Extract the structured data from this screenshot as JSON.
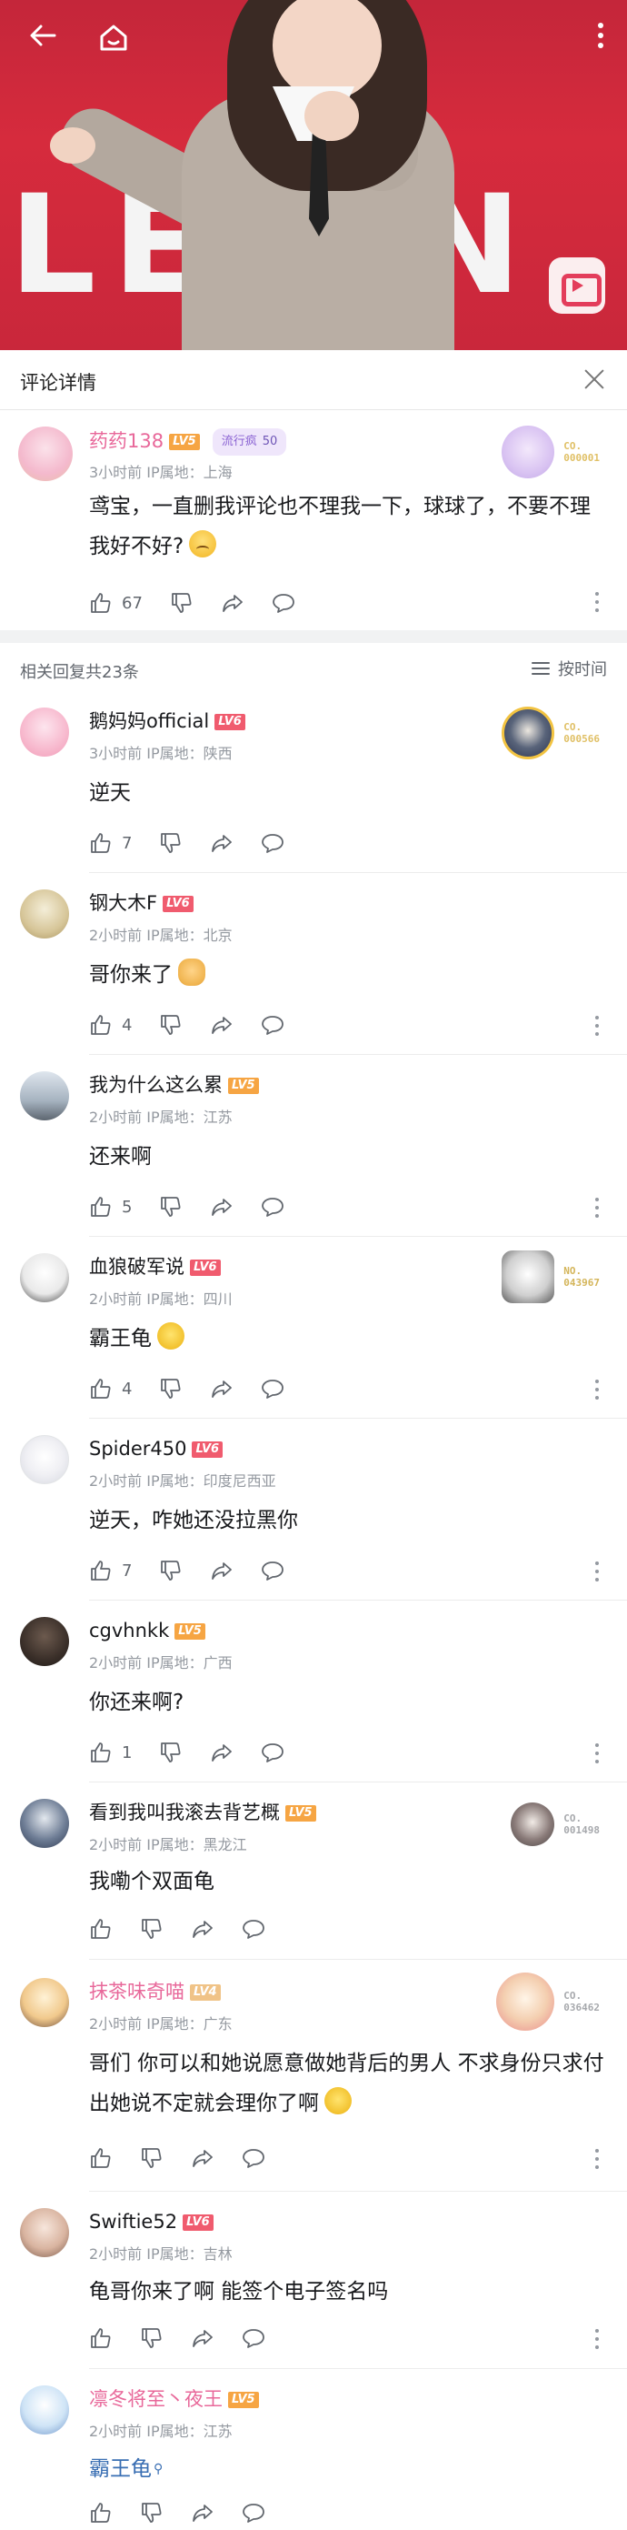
{
  "detail": {
    "title": "评论详情"
  },
  "main_comment": {
    "user": "药药138",
    "level": "LV5",
    "level_color": "#f6a543",
    "tag_name": "流行疯",
    "tag_num": "50",
    "time": "3小时前",
    "ip": "IP属地：上海",
    "content": "鸢宝，一直删我评论也不理我一下，球球了，不要不理我好不好?",
    "likes": "67",
    "badge_no": "CO.\n000001"
  },
  "replies_header": {
    "count_label": "相关回复共23条",
    "sort_label": "按时间"
  },
  "replies": [
    {
      "user": "鹅妈妈official",
      "level": "LV6",
      "time": "3小时前",
      "ip": "IP属地：陕西",
      "content": "逆天",
      "likes": "7",
      "badge_no": "CO.\n000566"
    },
    {
      "user": "钢大木F",
      "level": "LV6",
      "time": "2小时前",
      "ip": "IP属地：北京",
      "content": "哥你来了",
      "likes": "4"
    },
    {
      "user": "我为什么这么累",
      "level": "LV5",
      "time": "2小时前",
      "ip": "IP属地：江苏",
      "content": "还来啊",
      "likes": "5"
    },
    {
      "user": "血狼破军说",
      "level": "LV6",
      "time": "2小时前",
      "ip": "IP属地：四川",
      "content": "霸王龟",
      "likes": "4",
      "badge_no": "NO.\n043967"
    },
    {
      "user": "Spider450",
      "level": "LV6",
      "time": "2小时前",
      "ip": "IP属地：印度尼西亚",
      "content": "逆天，咋她还没拉黑你",
      "likes": "7"
    },
    {
      "user": "cgvhnkk",
      "level": "LV5",
      "time": "2小时前",
      "ip": "IP属地：广西",
      "content": "你还来啊?",
      "likes": "1"
    },
    {
      "user": "看到我叫我滚去背艺概",
      "level": "LV5",
      "time": "2小时前",
      "ip": "IP属地：黑龙江",
      "content": "我嘞个双面龟",
      "likes": "",
      "badge_no": "CO.\n001498"
    },
    {
      "user": "抹茶味奇喵",
      "level": "LV4",
      "time": "2小时前",
      "ip": "IP属地：广东",
      "content": "哥们 你可以和她说愿意做她背后的男人 不求身份只求付出她说不定就会理你了啊",
      "likes": "",
      "badge_no": "CO.\n036462"
    },
    {
      "user": "Swiftie52",
      "level": "LV6",
      "time": "2小时前",
      "ip": "IP属地：吉林",
      "content": "龟哥你来了啊 能签个电子签名吗",
      "likes": ""
    },
    {
      "user": "凛冬将至丶夜王",
      "level": "LV5",
      "time": "2小时前",
      "ip": "IP属地：江苏",
      "content": "霸王龟",
      "likes": ""
    }
  ]
}
